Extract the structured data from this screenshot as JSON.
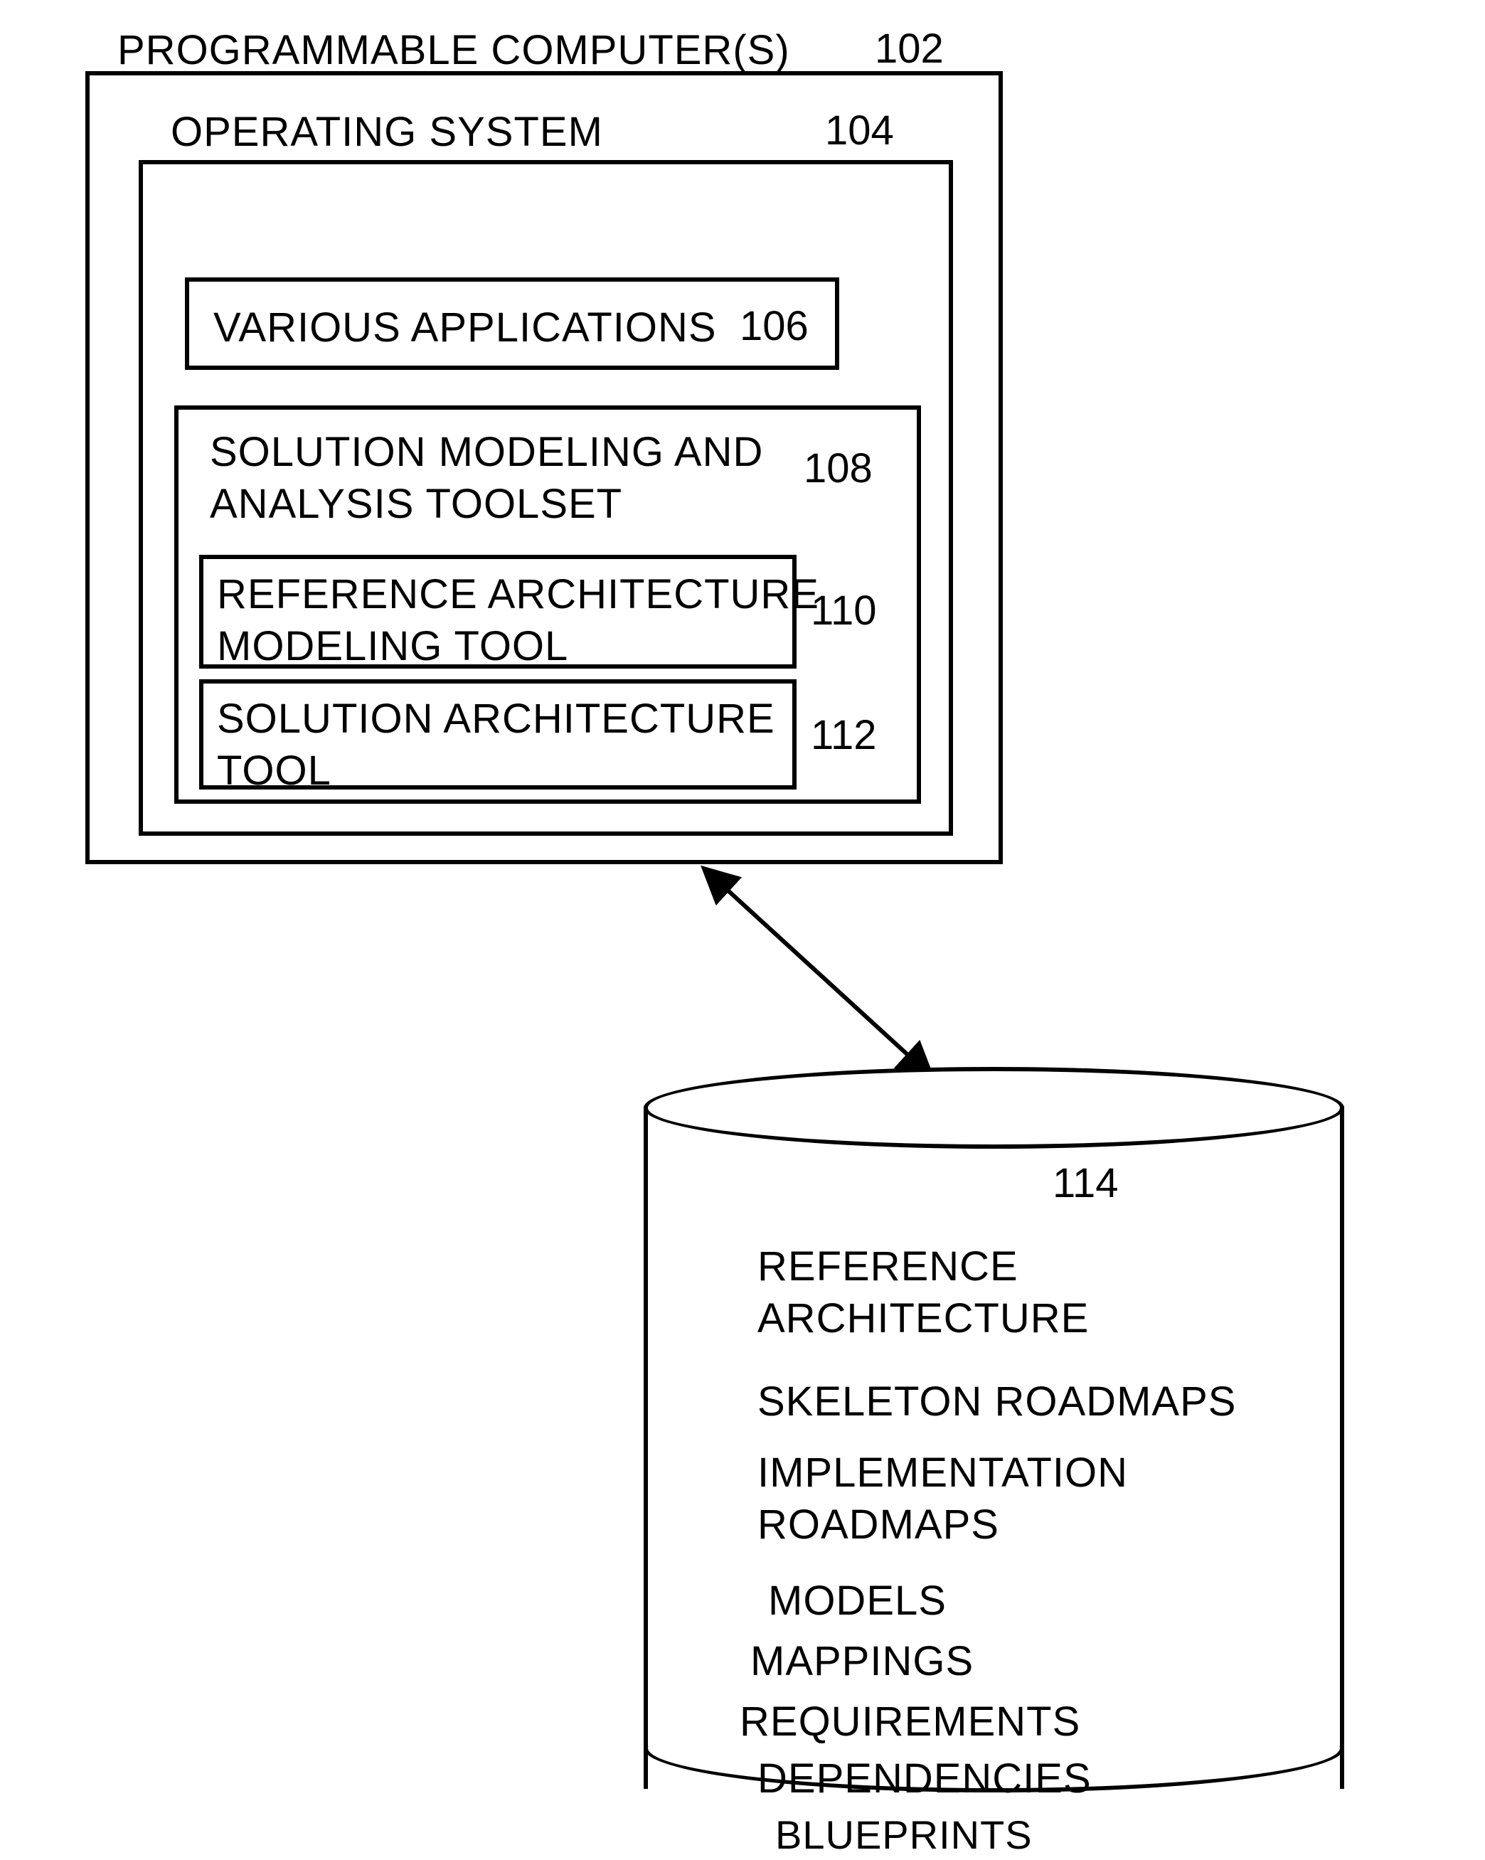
{
  "outer": {
    "title": "PROGRAMMABLE COMPUTER(S)",
    "ref": "102"
  },
  "os": {
    "title": "OPERATING SYSTEM",
    "ref": "104"
  },
  "apps": {
    "title": "VARIOUS APPLICATIONS",
    "ref": "106"
  },
  "toolset": {
    "title": "SOLUTION MODELING AND\nANALYSIS TOOLSET",
    "ref": "108"
  },
  "ram": {
    "title": "REFERENCE ARCHITECTURE\nMODELING TOOL",
    "ref": "110"
  },
  "sat": {
    "title": "SOLUTION ARCHITECTURE\nTOOL",
    "ref": "112"
  },
  "db": {
    "ref": "114",
    "items": [
      "REFERENCE\nARCHITECTURE",
      "SKELETON ROADMAPS",
      "IMPLEMENTATION\nROADMAPS",
      "MODELS",
      "MAPPINGS",
      "REQUIREMENTS",
      "DEPENDENCIES",
      "BLUEPRINTS"
    ]
  }
}
